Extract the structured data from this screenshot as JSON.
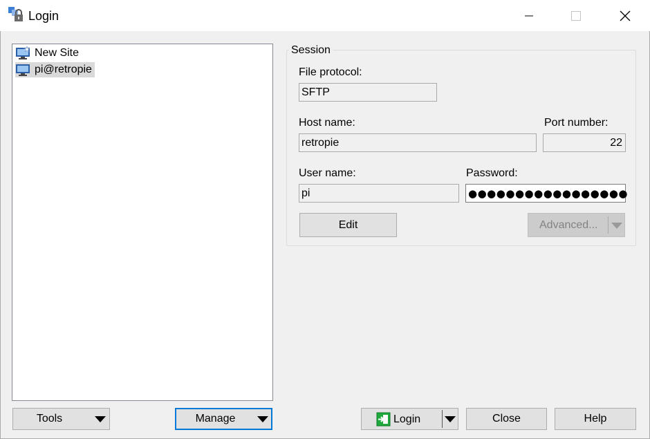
{
  "window": {
    "title": "Login",
    "icon": "app-lock-icon"
  },
  "sites": [
    {
      "label": "New Site",
      "icon": "new-site-monitor-icon",
      "selected": false
    },
    {
      "label": "pi@retropie",
      "icon": "monitor-icon",
      "selected": true
    }
  ],
  "session": {
    "group_label": "Session",
    "file_protocol_label": "File protocol:",
    "file_protocol_value": "SFTP",
    "host_name_label": "Host name:",
    "host_name_value": "retropie",
    "port_label": "Port number:",
    "port_value": "22",
    "user_name_label": "User name:",
    "user_name_value": "pi",
    "password_label": "Password:",
    "password_value": "●●●●●●●●●●●●●●●●●",
    "edit_label": "Edit",
    "advanced_label": "Advanced..."
  },
  "bottom": {
    "tools_label": "Tools",
    "manage_label": "Manage",
    "login_label": "Login",
    "close_label": "Close",
    "help_label": "Help"
  },
  "colors": {
    "accent": "#0078d7",
    "login_icon": "#1fa83b"
  }
}
